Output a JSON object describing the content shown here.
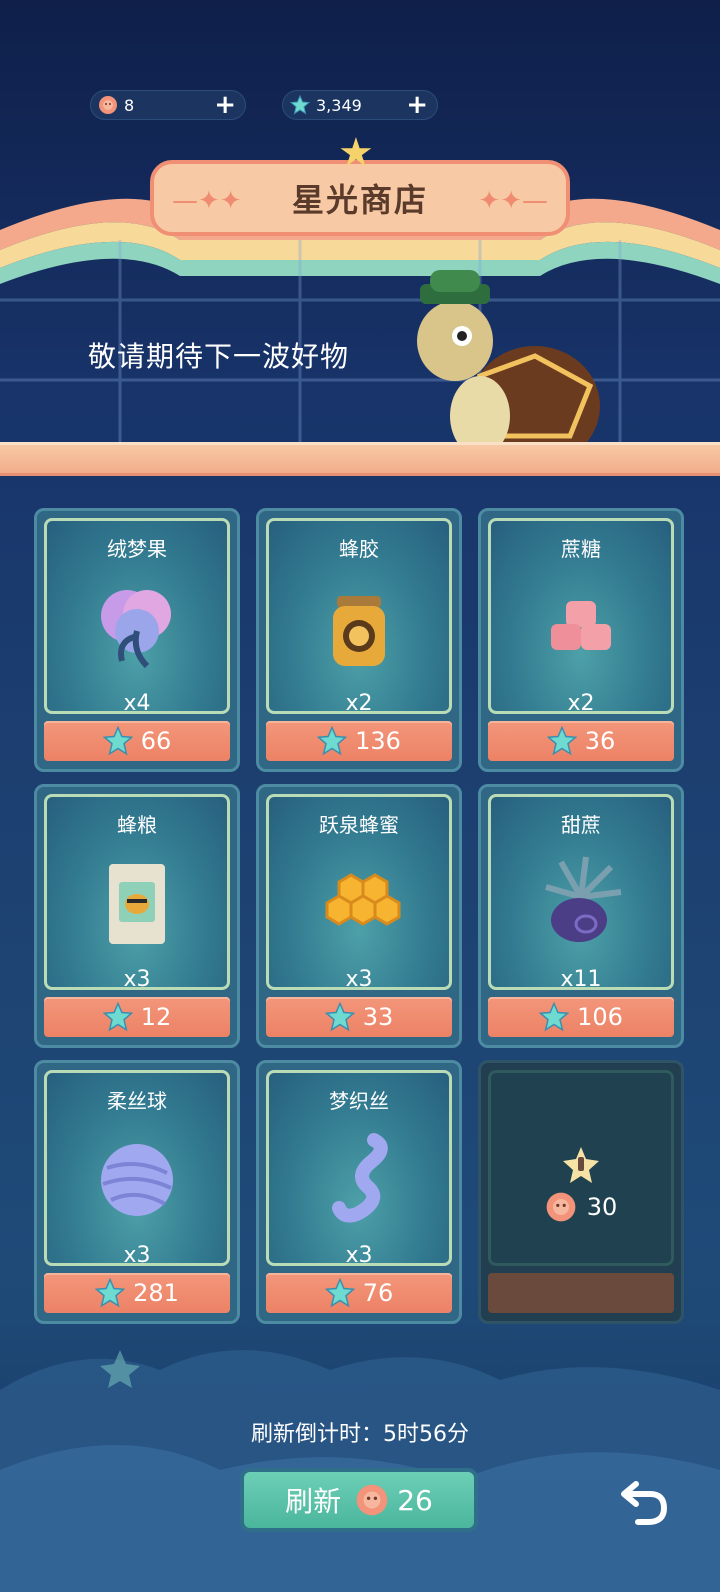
{
  "currency": {
    "flower_value": "8",
    "star_value": "3,349",
    "plus_label": "+"
  },
  "shop": {
    "title": "星光商店",
    "tagline": "敬请期待下一波好物"
  },
  "items": [
    {
      "name": "绒梦果",
      "qty": "x4",
      "price": "66",
      "icon": "cotton-flower-icon"
    },
    {
      "name": "蜂胶",
      "qty": "x2",
      "price": "136",
      "icon": "propolis-jar-icon"
    },
    {
      "name": "蔗糖",
      "qty": "x2",
      "price": "36",
      "icon": "sugar-cubes-icon"
    },
    {
      "name": "蜂粮",
      "qty": "x3",
      "price": "12",
      "icon": "bee-bread-bag-icon"
    },
    {
      "name": "跃泉蜂蜜",
      "qty": "x3",
      "price": "33",
      "icon": "honeycomb-icon"
    },
    {
      "name": "甜蔗",
      "qty": "x11",
      "price": "106",
      "icon": "sugarcane-pot-icon"
    },
    {
      "name": "柔丝球",
      "qty": "x3",
      "price": "281",
      "icon": "yarn-ball-icon"
    },
    {
      "name": "梦织丝",
      "qty": "x3",
      "price": "76",
      "icon": "silk-skein-icon"
    }
  ],
  "locked_slot": {
    "unlock_cost": "30",
    "icon": "locked-slot-icon"
  },
  "footer": {
    "countdown": "刷新倒计时：5时56分",
    "refresh_label": "刷新",
    "refresh_cost": "26"
  },
  "colors": {
    "accent_coral": "#ec8266",
    "accent_green": "#4bb69d",
    "background": "#1d4272"
  }
}
